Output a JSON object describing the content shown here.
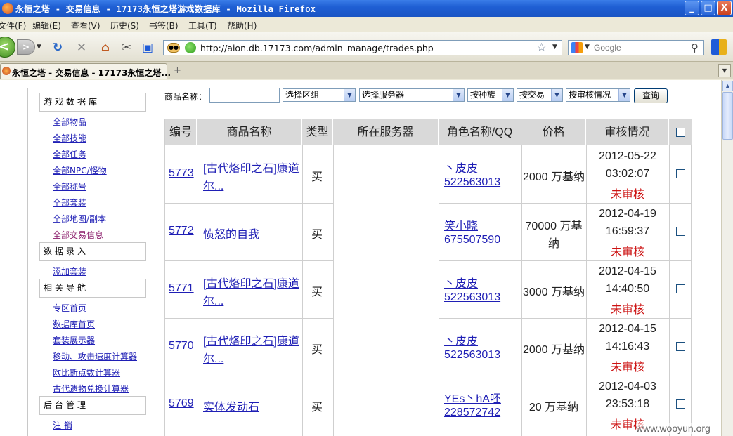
{
  "window": {
    "title": "永恒之塔 - 交易信息 - 17173永恒之塔游戏数据库 - Mozilla Firefox",
    "controls": {
      "minimize": "_",
      "maximize": "□",
      "close": "X"
    }
  },
  "menu": [
    "文件(F)",
    "编辑(E)",
    "查看(V)",
    "历史(S)",
    "书签(B)",
    "工具(T)",
    "帮助(H)"
  ],
  "toolbar": {
    "url": "http://aion.db.17173.com/admin_manage/trades.php",
    "search_placeholder": "Google"
  },
  "tab": {
    "title": "永恒之塔 - 交易信息 - 17173永恒之塔..."
  },
  "sidebar": {
    "sections": [
      {
        "heading": "游戏数据库",
        "links": [
          "全部物品",
          "全部技能",
          "全部任务",
          "全部NPC/怪物",
          "全部称号",
          "全部套装",
          "全部地图/副本",
          "全部交易信息"
        ]
      },
      {
        "heading": "数据录入",
        "links": [
          "添加套装"
        ]
      },
      {
        "heading": "相关导航",
        "links": [
          "专区首页",
          "数据库首页",
          "套装展示器",
          "移动、攻击速度计算器",
          "欧比斯点数计算器",
          "古代遗物兑换计算器"
        ]
      },
      {
        "heading": "后台管理",
        "links": [
          "注 销"
        ]
      }
    ]
  },
  "filters": {
    "name_label": "商品名称：",
    "name_value": "",
    "selects": [
      "选择区组",
      "选择服务器",
      "按种族",
      "按交易",
      "按审核情况"
    ],
    "submit": "查询"
  },
  "table": {
    "columns": [
      "编号",
      "商品名称",
      "类型",
      "所在服务器",
      "角色名称/QQ",
      "价格",
      "审核情况"
    ],
    "rows": [
      {
        "id": "5773",
        "name": [
          "[古代烙印之石]康道",
          "尔..."
        ],
        "type": "买",
        "server": "",
        "role": "丶皮皮",
        "qq": "522563013",
        "price": [
          "2000 万基纳"
        ],
        "date": "2012-05-22",
        "time": "03:02:07",
        "status": "未审核"
      },
      {
        "id": "5772",
        "name": [
          "愤怒的自我"
        ],
        "type": "买",
        "server": "",
        "role": "笑小晓",
        "qq": "675507590",
        "price": [
          "70000 万基",
          "纳"
        ],
        "date": "2012-04-19",
        "time": "16:59:37",
        "status": "未审核"
      },
      {
        "id": "5771",
        "name": [
          "[古代烙印之石]康道",
          "尔..."
        ],
        "type": "买",
        "server": "",
        "role": "丶皮皮",
        "qq": "522563013",
        "price": [
          "3000 万基纳"
        ],
        "date": "2012-04-15",
        "time": "14:40:50",
        "status": "未审核"
      },
      {
        "id": "5770",
        "name": [
          "[古代烙印之石]康道",
          "尔..."
        ],
        "type": "买",
        "server": "",
        "role": "丶皮皮",
        "qq": "522563013",
        "price": [
          "2000 万基纳"
        ],
        "date": "2012-04-15",
        "time": "14:16:43",
        "status": "未审核"
      },
      {
        "id": "5769",
        "name": [
          "实体发动石"
        ],
        "type": "买",
        "server": "",
        "role": "YEs丶hA呸",
        "qq": "228572742",
        "price": [
          "20 万基纳"
        ],
        "date": "2012-04-03",
        "time": "23:53:18",
        "status": "未审核"
      }
    ]
  },
  "watermark": "www.wooyun.org",
  "colors": {
    "link": "#1f1fb5",
    "visited": "#8a1a6a",
    "status": "#cc1111",
    "header_bg": "#d9d9d9",
    "titlebar": "#1f5fd4"
  }
}
